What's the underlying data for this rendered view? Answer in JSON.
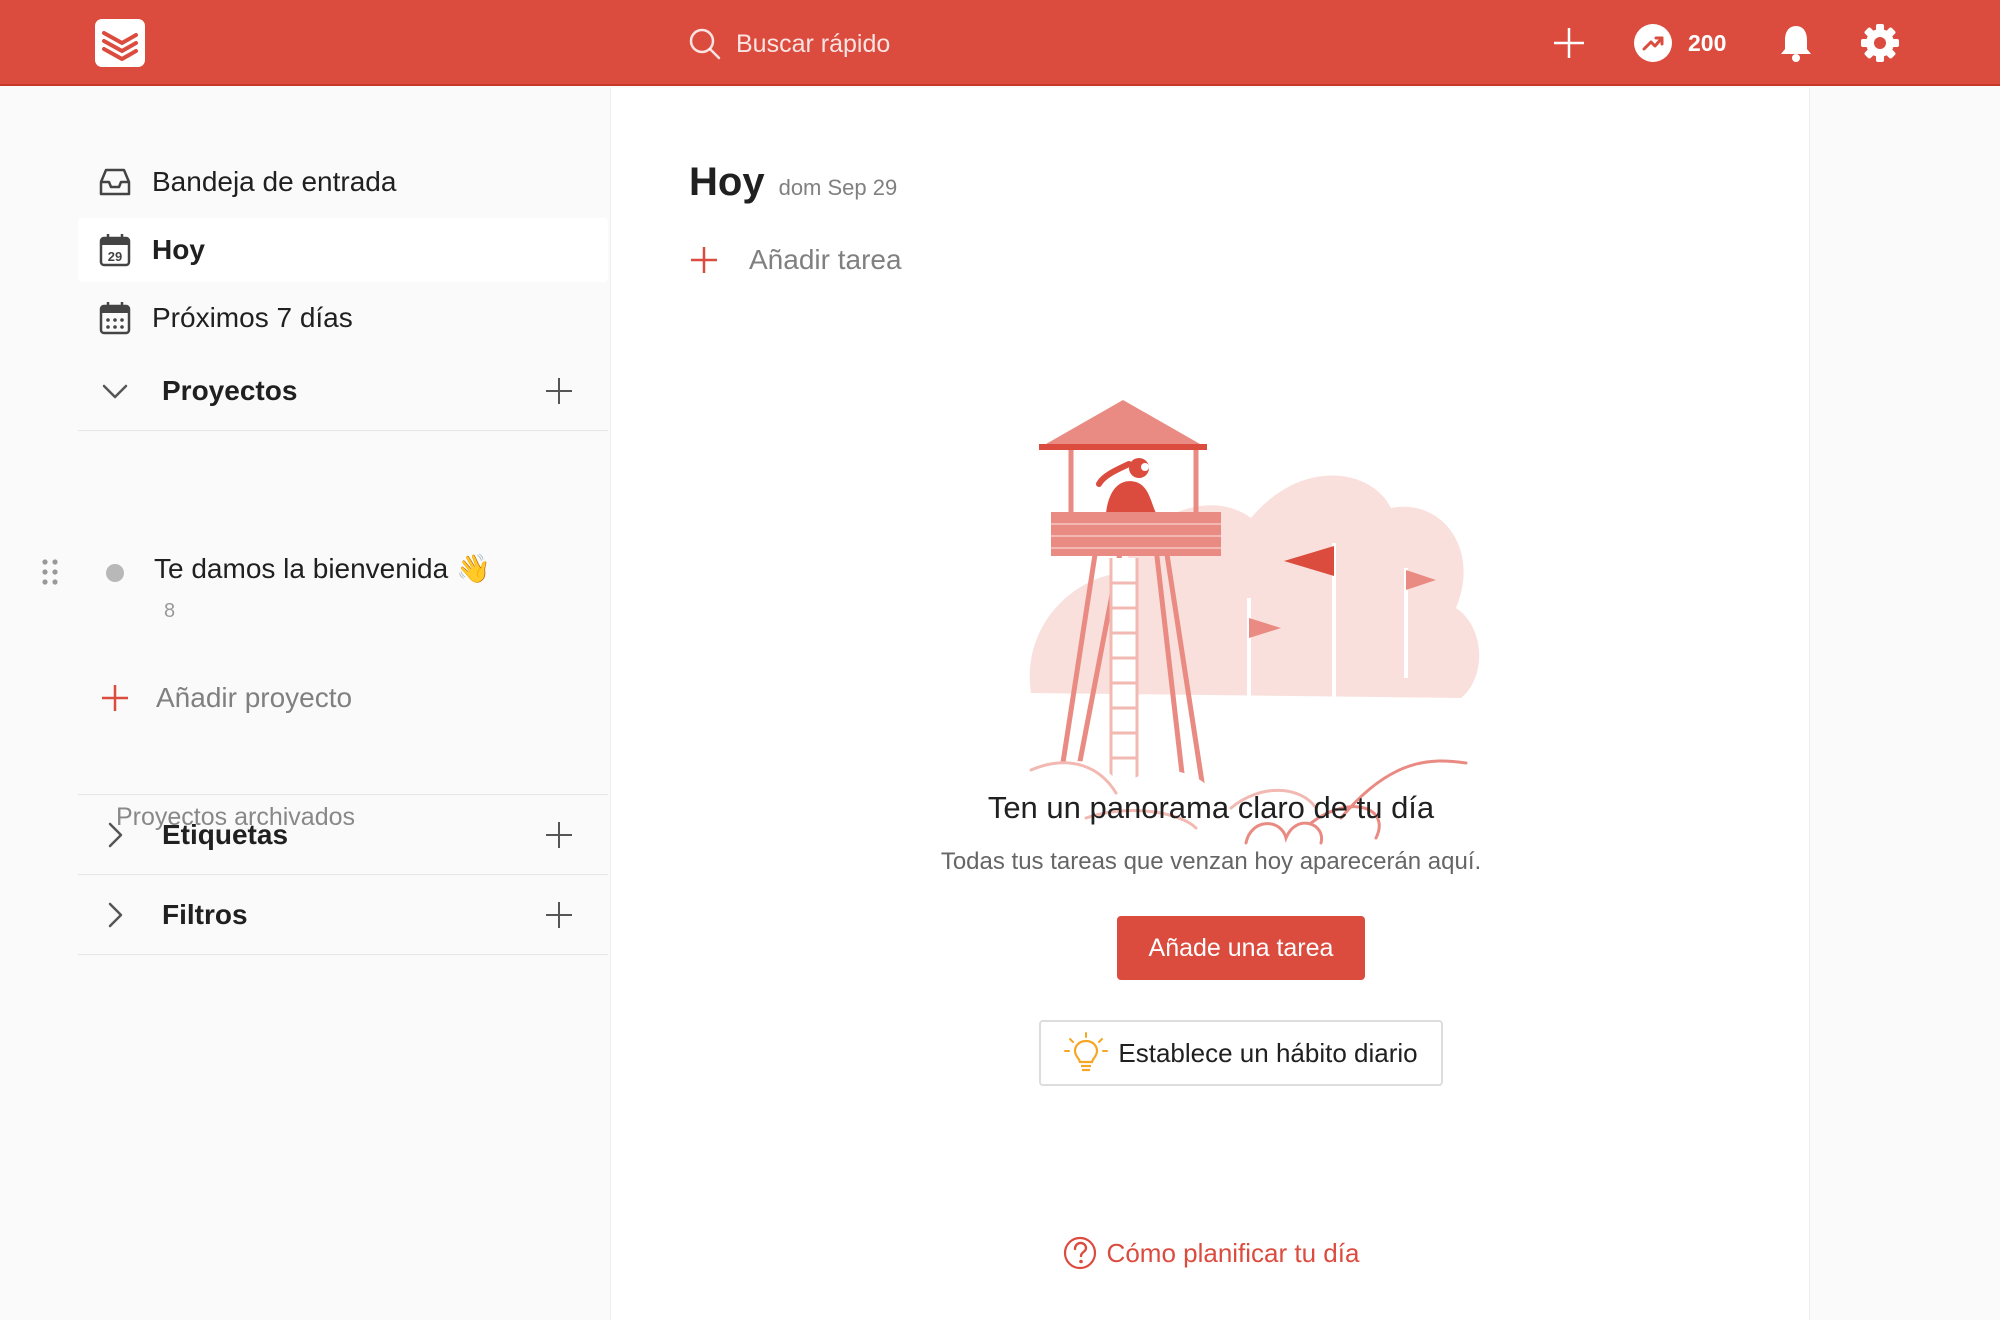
{
  "topbar": {
    "search_placeholder": "Buscar rápido",
    "karma_points": "200",
    "accent_color": "#db4c3f"
  },
  "sidebar": {
    "nav": [
      {
        "label": "Bandeja de entrada",
        "icon": "inbox-icon"
      },
      {
        "label": "Hoy",
        "icon": "calendar-today-icon",
        "day": "29",
        "active": true
      },
      {
        "label": "Próximos 7 días",
        "icon": "calendar-week-icon"
      }
    ],
    "projects_header": "Proyectos",
    "projects": [
      {
        "name": "Te damos la bienvenida 👋",
        "count": "8",
        "color": "#b8b8b8"
      }
    ],
    "add_project_label": "Añadir proyecto",
    "archived_label": "Proyectos archivados",
    "labels_header": "Etiquetas",
    "filters_header": "Filtros"
  },
  "main": {
    "title": "Hoy",
    "date": "dom Sep 29",
    "add_task_label": "Añadir tarea",
    "empty_title": "Ten un panorama claro de tu día",
    "empty_subtitle": "Todas tus tareas que venzan hoy aparecerán aquí.",
    "primary_button": "Añade una tarea",
    "habit_button": "Establece un hábito diario",
    "help_link": "Cómo planificar tu día"
  }
}
